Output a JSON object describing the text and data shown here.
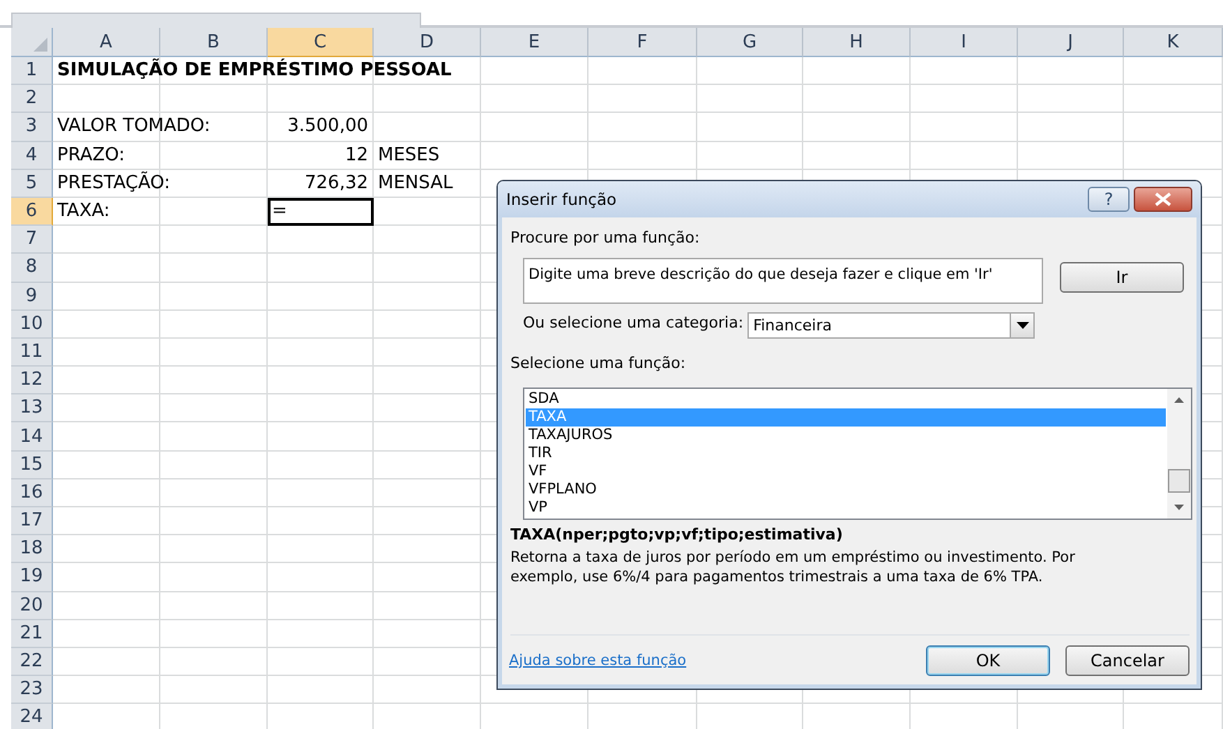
{
  "columns": [
    {
      "label": "A",
      "selected": false
    },
    {
      "label": "B",
      "selected": false
    },
    {
      "label": "C",
      "selected": true
    },
    {
      "label": "D",
      "selected": false
    },
    {
      "label": "E",
      "selected": false
    },
    {
      "label": "F",
      "selected": false
    },
    {
      "label": "G",
      "selected": false
    },
    {
      "label": "H",
      "selected": false
    },
    {
      "label": "I",
      "selected": false
    },
    {
      "label": "J",
      "selected": false
    },
    {
      "label": "K",
      "selected": false
    }
  ],
  "rows": [
    {
      "number": "1",
      "selected": false,
      "column_a": {
        "text": "SIMULAÇÃO DE EMPRÉSTIMO PESSOAL",
        "kind": "title"
      }
    },
    {
      "number": "2",
      "selected": false
    },
    {
      "number": "3",
      "selected": false,
      "column_a": {
        "text": "VALOR TOMADO:",
        "kind": "text"
      },
      "column_c": {
        "text": "3.500,00",
        "kind": "number"
      }
    },
    {
      "number": "4",
      "selected": false,
      "column_a": {
        "text": "PRAZO:",
        "kind": "text"
      },
      "column_c": {
        "text": "12",
        "kind": "number"
      },
      "column_d": {
        "text": "MESES",
        "kind": "text"
      }
    },
    {
      "number": "5",
      "selected": false,
      "column_a": {
        "text": "PRESTAÇÃO:",
        "kind": "text"
      },
      "column_c": {
        "text": "726,32",
        "kind": "number"
      },
      "column_d": {
        "text": "MENSAL",
        "kind": "text"
      }
    },
    {
      "number": "6",
      "selected": true,
      "column_a": {
        "text": "TAXA:",
        "kind": "text"
      },
      "column_c": {
        "text": "=",
        "kind": "text"
      }
    },
    {
      "number": "7",
      "selected": false
    },
    {
      "number": "8",
      "selected": false
    },
    {
      "number": "9",
      "selected": false
    },
    {
      "number": "10",
      "selected": false
    },
    {
      "number": "11",
      "selected": false
    },
    {
      "number": "12",
      "selected": false
    },
    {
      "number": "13",
      "selected": false
    },
    {
      "number": "14",
      "selected": false
    },
    {
      "number": "15",
      "selected": false
    },
    {
      "number": "16",
      "selected": false
    },
    {
      "number": "17",
      "selected": false
    },
    {
      "number": "18",
      "selected": false
    },
    {
      "number": "19",
      "selected": false
    },
    {
      "number": "20",
      "selected": false
    },
    {
      "number": "21",
      "selected": false
    },
    {
      "number": "22",
      "selected": false
    },
    {
      "number": "23",
      "selected": false
    },
    {
      "number": "24",
      "selected": false
    }
  ],
  "dialog": {
    "title": "Inserir função",
    "help_button": "?",
    "search_label": "Procure por uma função:",
    "search_value": "Digite uma breve descrição do que deseja fazer e clique em 'Ir'",
    "go_button": "Ir",
    "category_label": "Ou selecione uma categoria:",
    "category_value": "Financeira",
    "list_label": "Selecione uma função:",
    "functions": [
      {
        "name": "SDA",
        "selected": false
      },
      {
        "name": "TAXA",
        "selected": true
      },
      {
        "name": "TAXAJUROS",
        "selected": false
      },
      {
        "name": "TIR",
        "selected": false
      },
      {
        "name": "VF",
        "selected": false
      },
      {
        "name": "VFPLANO",
        "selected": false
      },
      {
        "name": "VP",
        "selected": false
      }
    ],
    "signature": "TAXA(nper;pgto;vp;vf;tipo;estimativa)",
    "description": "Retorna a taxa de juros por período em um empréstimo ou investimento. Por exemplo, use 6%/4 para pagamentos trimestrais a uma taxa de 6% TPA.",
    "help_link": "Ajuda sobre esta função",
    "ok_button": "OK",
    "cancel_button": "Cancelar"
  }
}
